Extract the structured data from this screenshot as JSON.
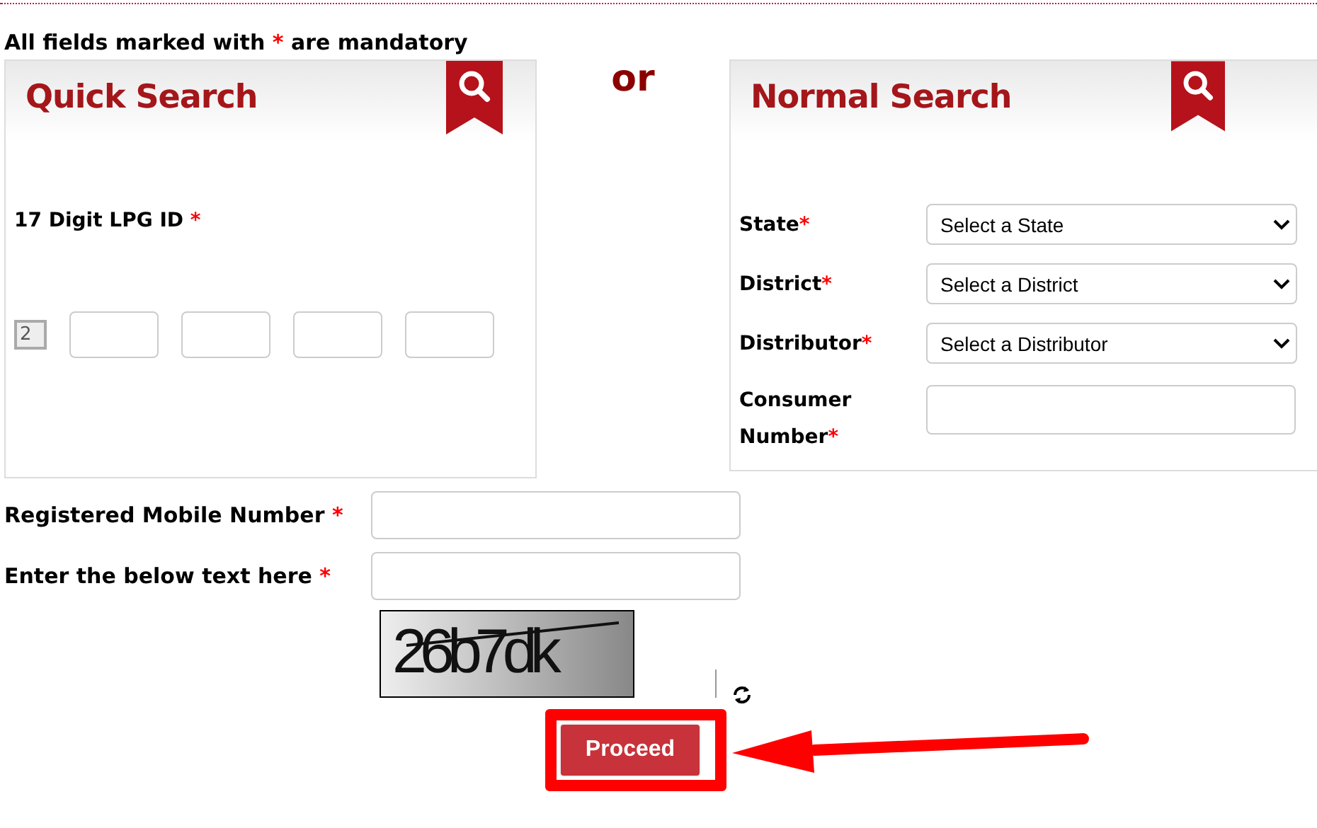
{
  "notice": {
    "before": "All fields marked with",
    "mark": "*",
    "after": "are mandatory"
  },
  "quick_search": {
    "title": "Quick Search",
    "label": "17 Digit LPG ID",
    "required_mark": "*",
    "prefix": "2"
  },
  "separator": "or",
  "normal_search": {
    "title": "Normal Search",
    "fields": [
      {
        "kind": "select",
        "label": "State",
        "required_mark": "*",
        "value": "Select a State"
      },
      {
        "kind": "select",
        "label": "District",
        "required_mark": "*",
        "value": "Select a District"
      },
      {
        "kind": "select",
        "label": "Distributor",
        "required_mark": "*",
        "value": "Select a Distributor"
      },
      {
        "kind": "input",
        "label": "Consumer Number",
        "required_mark": "*"
      }
    ]
  },
  "form_fields": [
    {
      "label": "Registered Mobile Number",
      "required_mark": "*"
    },
    {
      "label": "Enter the below text here",
      "required_mark": "*"
    }
  ],
  "captcha": {
    "text": "26b7dk"
  },
  "proceed_button": "Proceed"
}
